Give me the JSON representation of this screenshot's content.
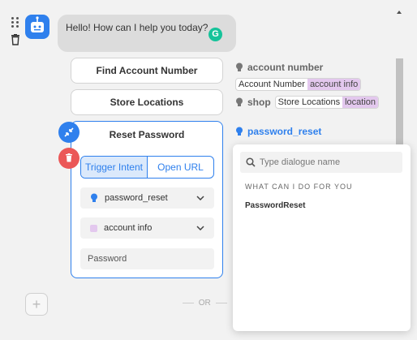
{
  "chat": {
    "greeting": "Hello! How can I help you today?",
    "grammarly_glyph": "G"
  },
  "buttons": [
    {
      "label": "Find Account Number"
    },
    {
      "label": "Store Locations"
    }
  ],
  "entities": {
    "account": {
      "name": "account number",
      "tag_value": "Account Number",
      "tag_entity": "account info"
    },
    "shop": {
      "name": "shop",
      "tag_value": "Store Locations",
      "tag_entity": "location"
    },
    "password_reset": {
      "name": "password_reset"
    }
  },
  "reset_card": {
    "title": "Reset Password",
    "tabs": [
      "Trigger Intent",
      "Open URL"
    ],
    "active_tab": "Trigger Intent",
    "intent_select": "password_reset",
    "entity_select": "account info",
    "password_field": "Password"
  },
  "separator": "OR",
  "add_glyph": "+",
  "dropdown": {
    "search_placeholder": "Type dialogue name",
    "heading": "WHAT CAN I DO FOR YOU",
    "items": [
      "PasswordReset"
    ]
  },
  "colors": {
    "accent": "#2f80ed",
    "danger": "#eb5757",
    "entity_tag": "#e3c8ee",
    "grammarly": "#15c39a"
  }
}
